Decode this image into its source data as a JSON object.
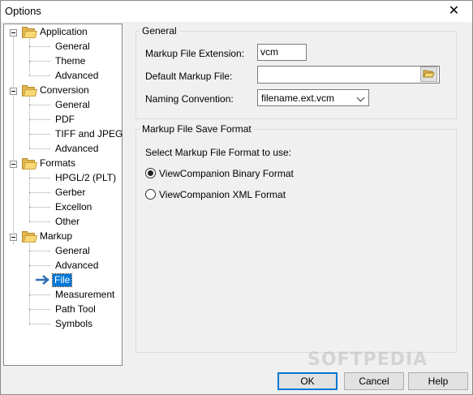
{
  "window": {
    "title": "Options",
    "close_glyph": "✕"
  },
  "tree": {
    "categories": [
      {
        "label": "Application",
        "children": [
          "General",
          "Theme",
          "Advanced"
        ]
      },
      {
        "label": "Conversion",
        "children": [
          "General",
          "PDF",
          "TIFF and JPEG",
          "Advanced"
        ]
      },
      {
        "label": "Formats",
        "children": [
          "HPGL/2 (PLT)",
          "Gerber",
          "Excellon",
          "Other"
        ]
      },
      {
        "label": "Markup",
        "children": [
          "General",
          "Advanced",
          "File",
          "Measurement",
          "Path Tool",
          "Symbols"
        ]
      }
    ],
    "selected": "File"
  },
  "general_group": {
    "title": "General",
    "extension_label": "Markup File Extension:",
    "extension_value": "vcm",
    "default_file_label": "Default Markup File:",
    "default_file_value": "",
    "naming_label": "Naming Convention:",
    "naming_value": "filename.ext.vcm"
  },
  "save_format_group": {
    "title": "Markup File Save Format",
    "prompt": "Select Markup File Format to use:",
    "options": [
      {
        "label": "ViewCompanion Binary Format",
        "checked": true
      },
      {
        "label": "ViewCompanion XML Format",
        "checked": false
      }
    ]
  },
  "buttons": {
    "ok": "OK",
    "cancel": "Cancel",
    "help": "Help"
  },
  "watermark": "SOFTPEDIA",
  "icons": {
    "folder": "folder-icon",
    "arrow": "selected-arrow-icon",
    "browse": "folder-open-icon"
  },
  "colors": {
    "selection": "#0078d7",
    "folder": "#f8d775"
  }
}
